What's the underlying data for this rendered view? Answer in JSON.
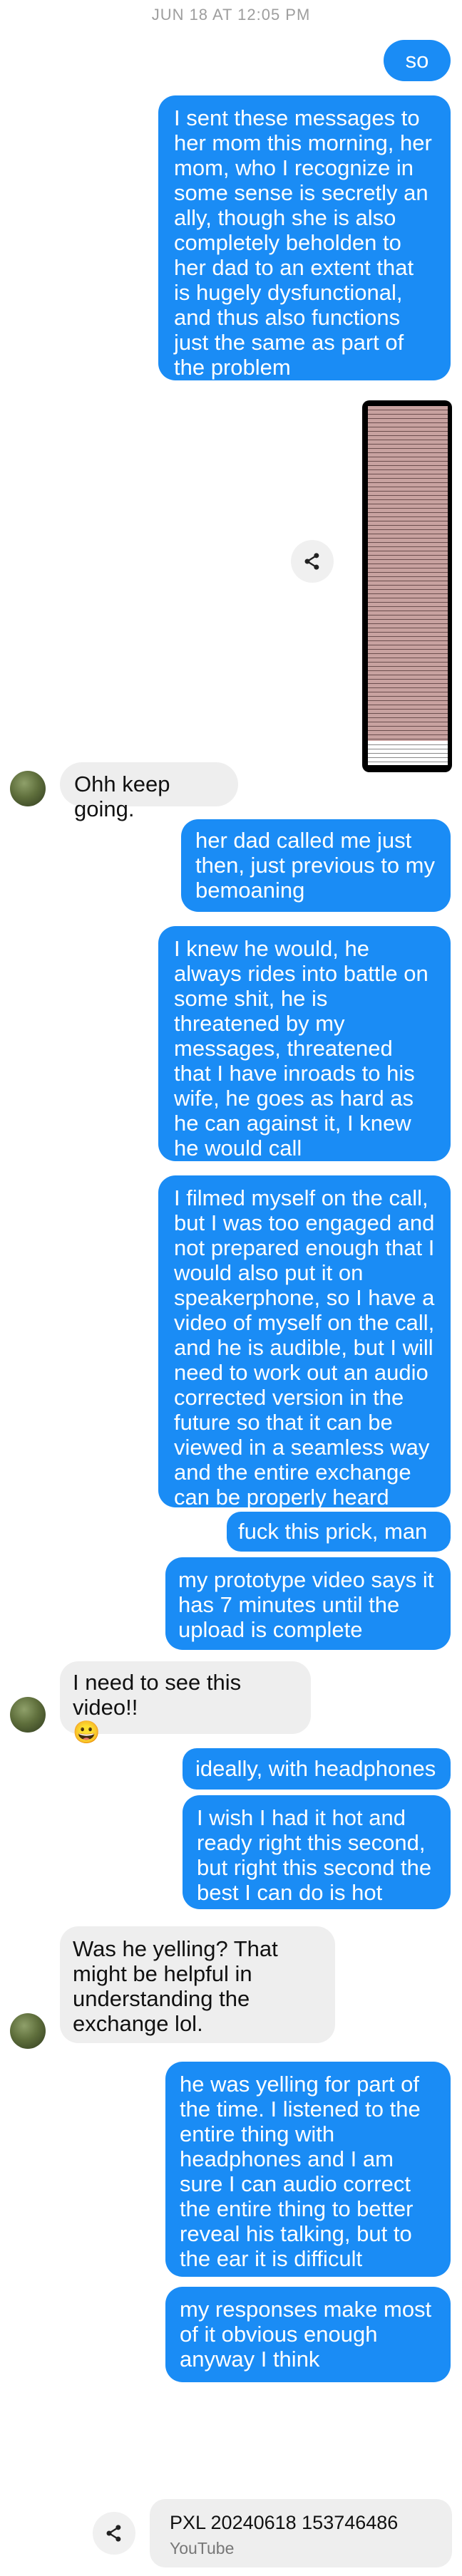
{
  "header": {
    "timestamp": "JUN 18 AT 12:05 PM"
  },
  "messages": [
    {
      "text": "so"
    },
    {
      "text": "I sent these messages to her mom this morning, her mom, who I recognize in some sense is secretly an ally, though she is also completely beholden to her dad to an extent that is hugely dysfunctional, and thus also functions just the same as part of the problem"
    },
    {
      "text": "Ohh keep going."
    },
    {
      "text": "her dad called me just then, just previous to my bemoaning"
    },
    {
      "text": "I knew he would, he always rides into battle on some shit, he is threatened by my messages, threatened that I have inroads to his wife, he goes as hard as he can against it, I knew he would call"
    },
    {
      "text": "I filmed myself on the call, but I was too engaged and not prepared enough that I would also put it on speakerphone, so I have a video of myself on the call, and he is audible, but I will need to work out an audio corrected version in the future so that it can be viewed in a seamless way and the entire exchange can be properly heard"
    },
    {
      "text": "fuck this prick, man"
    },
    {
      "text": "my prototype video says it has 7 minutes until the upload is complete"
    },
    {
      "text": "I need to see this video!!",
      "emoji": "😀"
    },
    {
      "text": "ideally, with headphones"
    },
    {
      "text": "I wish I had it hot and ready right this second, but right this second the best I can do is hot"
    },
    {
      "text": "Was he yelling? That might be helpful in understanding the exchange lol."
    },
    {
      "text": "he was yelling for part of the time. I listened to the entire thing with headphones and I am sure I can audio correct the entire thing to better reveal his talking, but to the ear it is difficult"
    },
    {
      "text": "my responses make most of it obvious enough anyway I think"
    }
  ],
  "link_card": {
    "title": "PXL 20240618 153746486",
    "source": "YouTube"
  },
  "colors": {
    "outgoing": "#1a8cf5",
    "incoming": "#eeeeee",
    "timestamp": "#9e9e9e"
  },
  "icons": {
    "share": "share-icon",
    "attachment": "screenshot-attachment"
  }
}
